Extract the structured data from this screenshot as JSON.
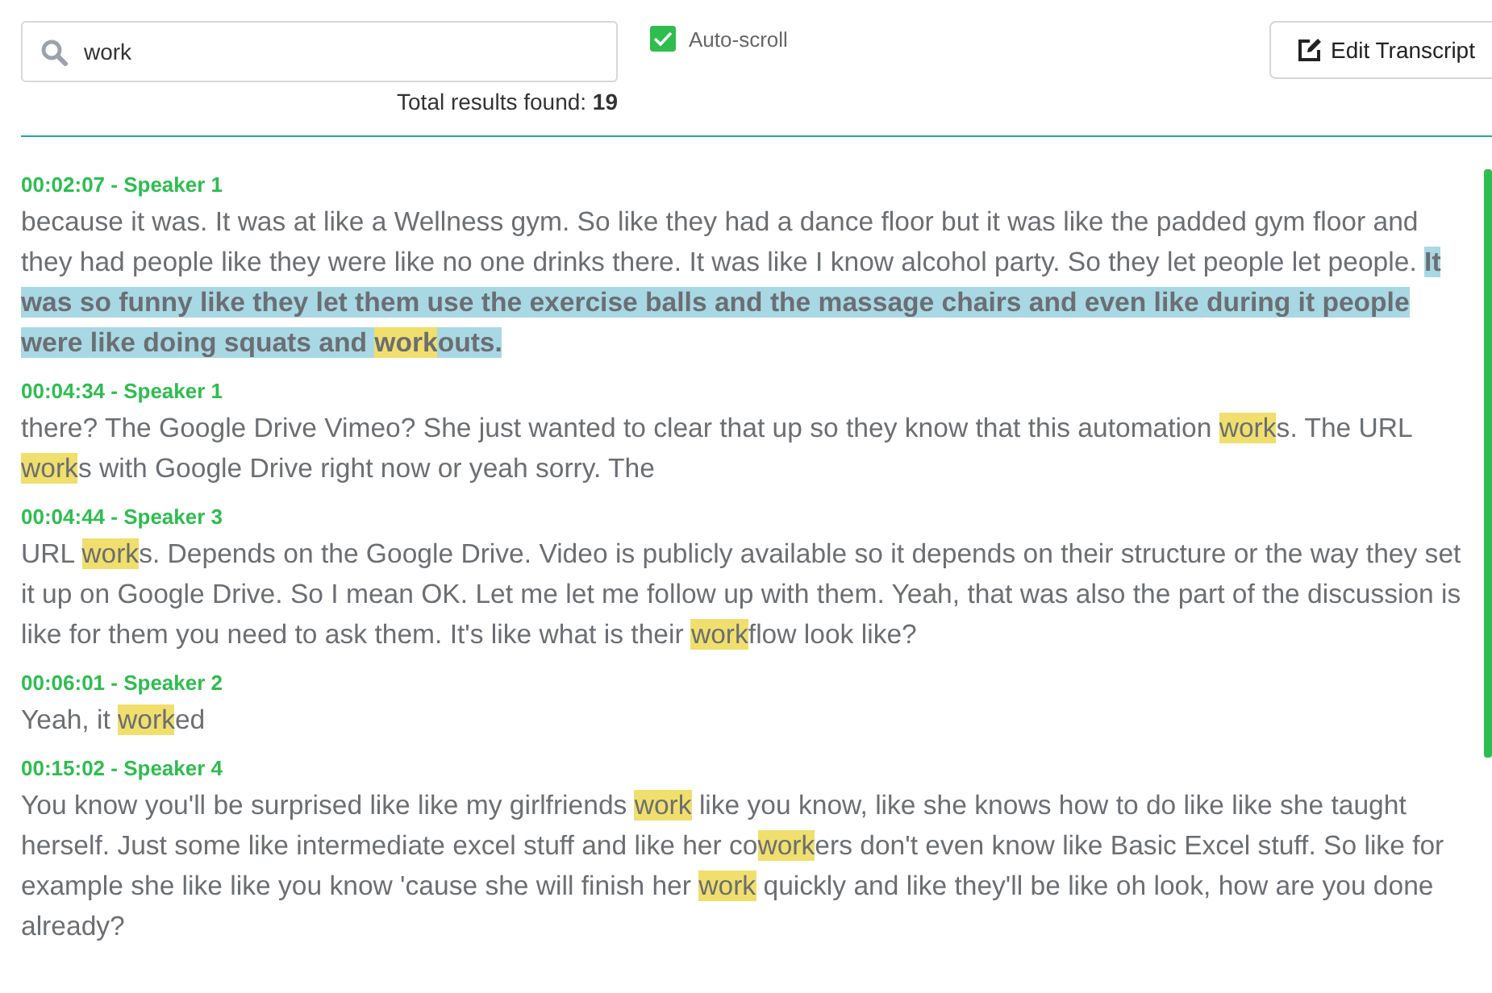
{
  "search": {
    "value": "work"
  },
  "results_summary": "Total results found: **19**",
  "auto_scroll": {
    "label": "Auto-scroll",
    "checked": true
  },
  "edit_button": {
    "label": "Edit Transcript"
  },
  "segments": [
    {
      "header": "00:02:07 - Speaker 1",
      "parts": [
        {
          "text": "because it was. It was at like a Wellness gym. So like they had a dance floor but it was like the padded gym floor and they had people like they were like no one drinks there. It was like I know alcohol party. So they let people let people. ",
          "match": false,
          "active": false
        },
        {
          "text": "It was so funny like they let them use the exercise balls and the massage chairs and even like during it people were like doing squats and ",
          "match": false,
          "active": true
        },
        {
          "text": "work",
          "match": true,
          "active": true
        },
        {
          "text": "outs.",
          "match": false,
          "active": true
        }
      ]
    },
    {
      "header": "00:04:34 - Speaker 1",
      "parts": [
        {
          "text": "there? The Google Drive Vimeo? She just wanted to clear that up so they know that this automation ",
          "match": false,
          "active": false
        },
        {
          "text": "work",
          "match": true,
          "active": false
        },
        {
          "text": "s. The URL ",
          "match": false,
          "active": false
        },
        {
          "text": "work",
          "match": true,
          "active": false
        },
        {
          "text": "s with Google Drive right now or yeah sorry. The",
          "match": false,
          "active": false
        }
      ]
    },
    {
      "header": "00:04:44 - Speaker 3",
      "parts": [
        {
          "text": "URL ",
          "match": false,
          "active": false
        },
        {
          "text": "work",
          "match": true,
          "active": false
        },
        {
          "text": "s. Depends on the Google Drive. Video is publicly available so it depends on their structure or the way they set it up on Google Drive. So I mean OK. Let me let me follow up with them. Yeah, that was also the part of the discussion is like for them you need to ask them. It's like what is their ",
          "match": false,
          "active": false
        },
        {
          "text": "work",
          "match": true,
          "active": false
        },
        {
          "text": "flow look like?",
          "match": false,
          "active": false
        }
      ]
    },
    {
      "header": "00:06:01 - Speaker 2",
      "parts": [
        {
          "text": "Yeah, it ",
          "match": false,
          "active": false
        },
        {
          "text": "work",
          "match": true,
          "active": false
        },
        {
          "text": "ed",
          "match": false,
          "active": false
        }
      ]
    },
    {
      "header": "00:15:02 - Speaker 4",
      "parts": [
        {
          "text": "You know you'll be surprised like like my girlfriends ",
          "match": false,
          "active": false
        },
        {
          "text": "work",
          "match": true,
          "active": false
        },
        {
          "text": " like you know, like she knows how to do like like she taught herself. Just some like intermediate excel stuff and like her co",
          "match": false,
          "active": false
        },
        {
          "text": "work",
          "match": true,
          "active": false
        },
        {
          "text": "ers don't even know like Basic Excel stuff. So like for example she like like you know 'cause she will finish her ",
          "match": false,
          "active": false
        },
        {
          "text": "work",
          "match": true,
          "active": false
        },
        {
          "text": " quickly and like they'll be like oh look, how are you done already?",
          "match": false,
          "active": false
        }
      ]
    }
  ]
}
